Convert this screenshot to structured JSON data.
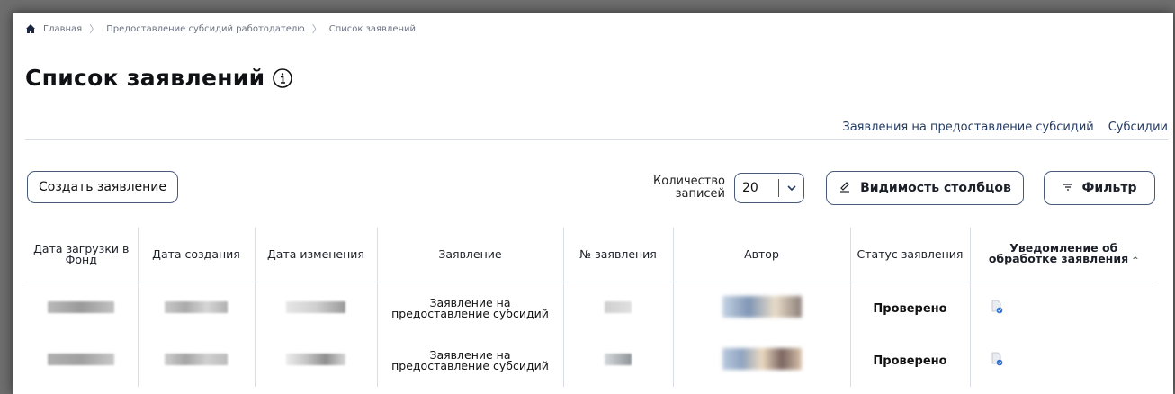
{
  "breadcrumb": {
    "home": "Главная",
    "level2": "Предоставление субсидий работодателю",
    "current": "Список заявлений"
  },
  "page": {
    "title": "Список заявлений"
  },
  "tabs": [
    "Заявления на предоставление субсидий",
    "Субсидии"
  ],
  "toolbar": {
    "create_label": "Создать заявление",
    "count_label_line1": "Количество",
    "count_label_line2": "записей",
    "count_value": "20",
    "columns_label": "Видимость столбцов",
    "filter_label": "Фильтр"
  },
  "table": {
    "headers": [
      "Дата загрузки в Фонд",
      "Дата создания",
      "Дата изменения",
      "Заявление",
      "№ заявления",
      "Автор",
      "Статус заявления",
      "Уведомление об обработке заявления"
    ],
    "rows": [
      {
        "application": "Заявление на предоставление субсидий",
        "status": "Проверено"
      },
      {
        "application": "Заявление на предоставление субсидий",
        "status": "Проверено"
      }
    ]
  },
  "colors": {
    "accent": "#243b64",
    "border": "#4a5a7a",
    "notice_check": "#2f6fd0"
  }
}
